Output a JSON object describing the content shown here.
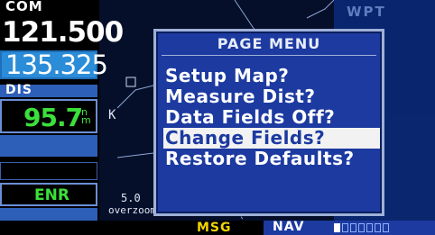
{
  "left_panel": {
    "com_label": "COM",
    "active_freq": "121.500",
    "standby_freq": "135.325",
    "dis_label": "DIS",
    "dis_value": "95.7",
    "dis_unit": "n m",
    "mode": "ENR"
  },
  "map": {
    "label_k": "K",
    "label_scale": "5.0",
    "label_overzoom": "overzoom"
  },
  "right_panel": {
    "wpt_label": "WPT"
  },
  "page_menu": {
    "title": "PAGE MENU",
    "items": [
      {
        "label": "Setup Map?"
      },
      {
        "label": "Measure Dist?"
      },
      {
        "label": "Data Fields Off?"
      },
      {
        "label": "Change Fields?"
      },
      {
        "label": "Restore Defaults?"
      }
    ],
    "selected_index": 3
  },
  "status_bar": {
    "msg": "MSG",
    "nav": "NAV",
    "page_count": 7,
    "current_page": 1
  },
  "colors": {
    "menu_bg": "#1c3aa0",
    "selection_bg": "#f2f2f2",
    "dis_value": "#3be03b",
    "msg": "#f2d400"
  }
}
